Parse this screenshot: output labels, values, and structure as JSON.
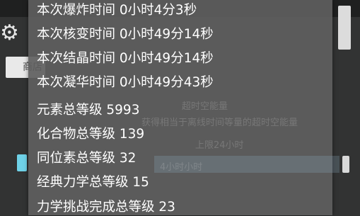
{
  "stats": [
    {
      "label": "本次爆炸时间 0小时4分3秒"
    },
    {
      "label": "本次核变时间 0小时49分14秒"
    },
    {
      "label": "本次结晶时间 0小时49分14秒"
    },
    {
      "label": "本次凝华时间 0小时49分43秒"
    },
    {
      "label": "元素总等级 5993"
    },
    {
      "label": "化合物总等级 139"
    },
    {
      "label": "同位素总等级 32"
    },
    {
      "label": "经典力学总等级 15"
    },
    {
      "label": "力学挑战完成总等级 23"
    }
  ],
  "background": {
    "button_label": "商店",
    "ghost_lines": [
      "超时空能量",
      "获得相当于离线时间等量的超时空能量",
      "上限24小时",
      "4小时小时"
    ]
  },
  "colors": {
    "overlay": "#5e5e5e",
    "text": "#ffffff",
    "accent": "#6fd2e8"
  }
}
